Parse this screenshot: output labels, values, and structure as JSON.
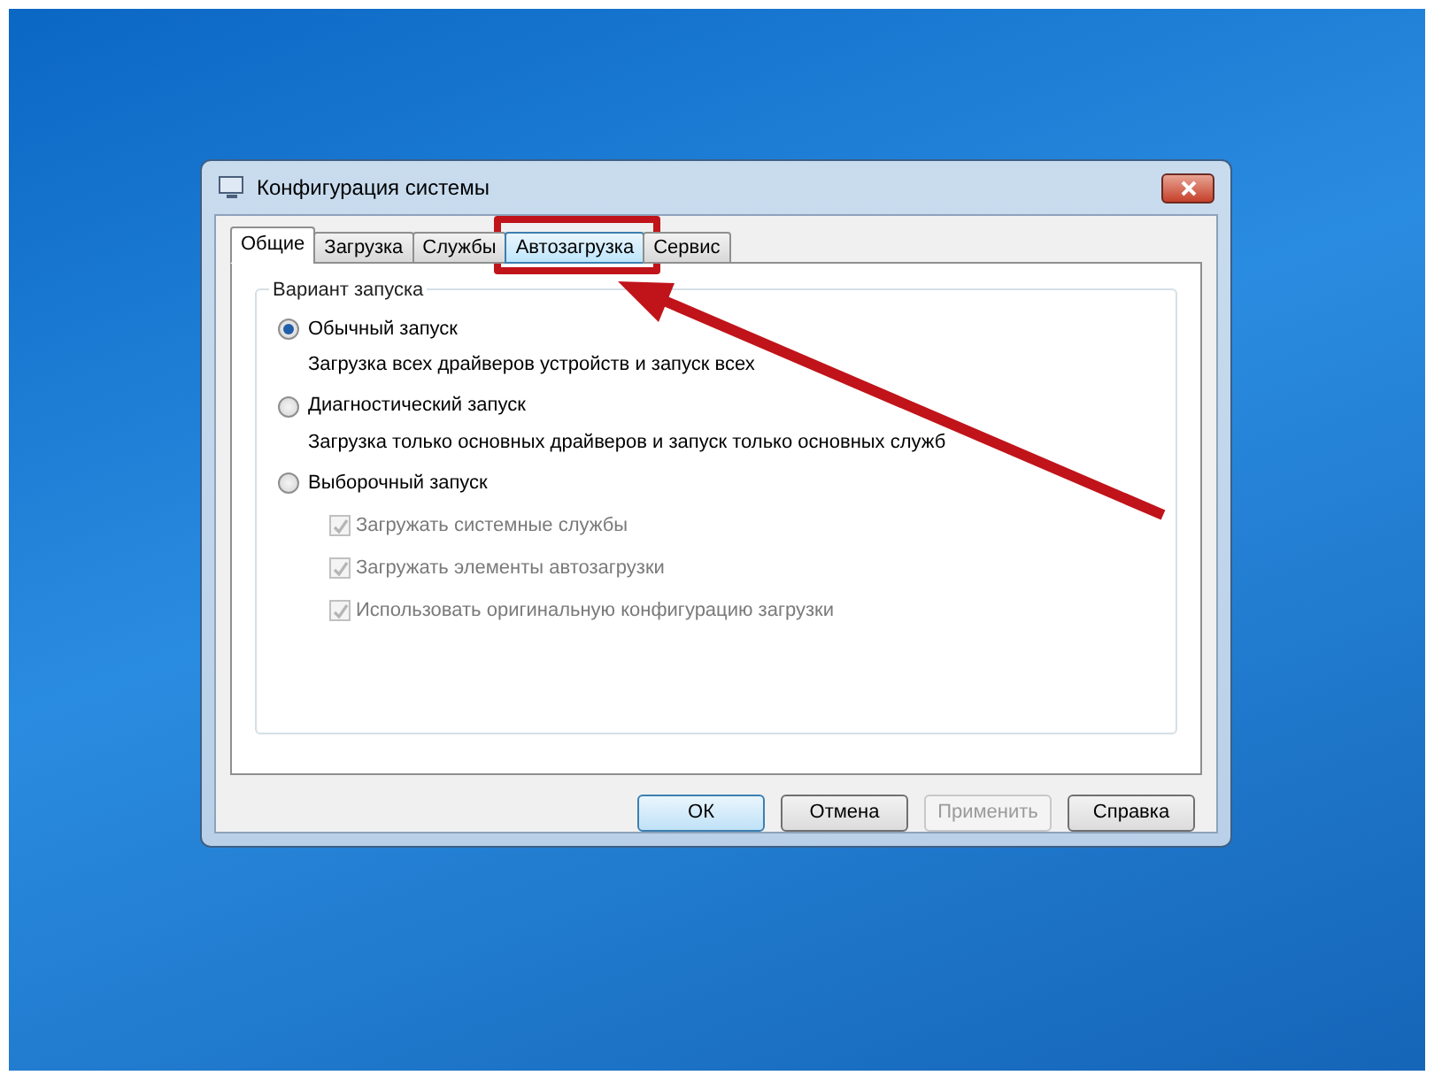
{
  "window": {
    "title": "Конфигурация системы"
  },
  "tabs": [
    {
      "label": "Общие",
      "selected": true,
      "highlighted": false
    },
    {
      "label": "Загрузка",
      "selected": false,
      "highlighted": false
    },
    {
      "label": "Службы",
      "selected": false,
      "highlighted": false
    },
    {
      "label": "Автозагрузка",
      "selected": false,
      "highlighted": true
    },
    {
      "label": "Сервис",
      "selected": false,
      "highlighted": false
    }
  ],
  "group": {
    "title": "Вариант запуска",
    "options": [
      {
        "label": "Обычный запуск",
        "description": "Загрузка всех драйверов устройств и запуск всех",
        "selected": true
      },
      {
        "label": "Диагностический запуск",
        "description": "Загрузка только основных драйверов и запуск только основных служб",
        "selected": false
      },
      {
        "label": "Выборочный запуск",
        "selected": false
      }
    ],
    "checkboxes": [
      {
        "label": "Загружать системные службы",
        "checked": true,
        "disabled": true
      },
      {
        "label": "Загружать элементы автозагрузки",
        "checked": true,
        "disabled": true
      },
      {
        "label": "Использовать оригинальную конфигурацию загрузки",
        "checked": true,
        "disabled": true
      }
    ]
  },
  "buttons": [
    {
      "label": "ОК",
      "default": true,
      "disabled": false
    },
    {
      "label": "Отмена",
      "default": false,
      "disabled": false
    },
    {
      "label": "Применить",
      "default": false,
      "disabled": true
    },
    {
      "label": "Справка",
      "default": false,
      "disabled": false
    }
  ]
}
